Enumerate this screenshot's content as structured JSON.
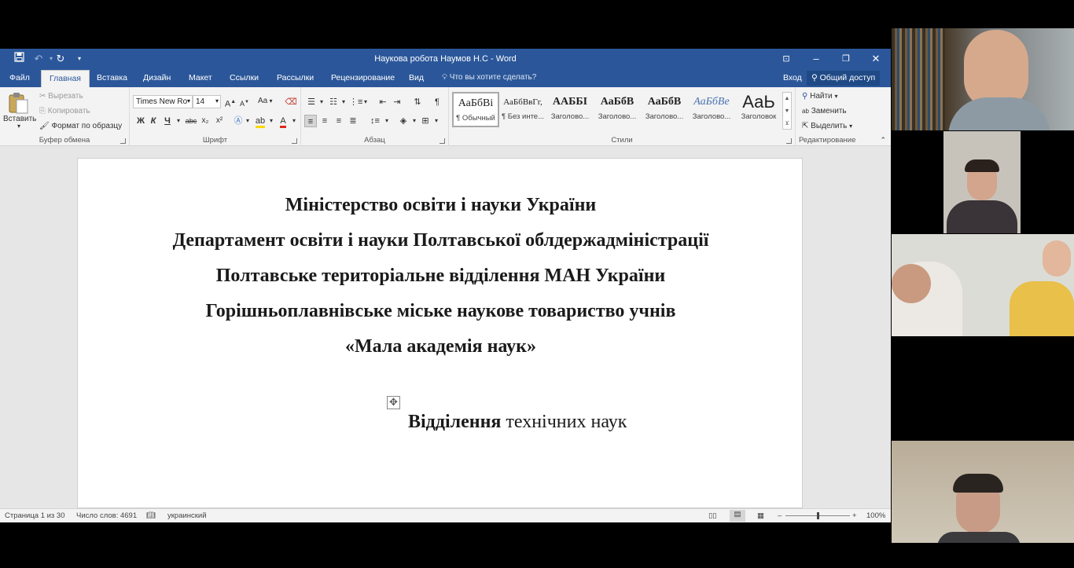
{
  "window": {
    "title": "Наукова робота Наумов Н.С - Word"
  },
  "tabs": {
    "file": "Файл",
    "home": "Главная",
    "insert": "Вставка",
    "design": "Дизайн",
    "layout": "Макет",
    "references": "Ссылки",
    "mailings": "Рассылки",
    "review": "Рецензирование",
    "view": "Вид",
    "tell_me": "Что вы хотите сделать?",
    "sign_in": "Вход",
    "share": "Общий доступ"
  },
  "ribbon": {
    "clipboard": {
      "paste": "Вставить",
      "cut": "Вырезать",
      "copy": "Копировать",
      "format_painter": "Формат по образцу",
      "label": "Буфер обмена"
    },
    "font": {
      "name": "Times New Ro",
      "size": "14",
      "bold": "Ж",
      "italic": "К",
      "underline": "Ч",
      "strike": "abc",
      "sub": "x₂",
      "sup": "x²",
      "case": "Aa",
      "label": "Шрифт"
    },
    "paragraph": {
      "label": "Абзац"
    },
    "styles": {
      "label": "Стили",
      "items": [
        {
          "preview": "АаБбВі",
          "caption": "¶ Обычный"
        },
        {
          "preview": "АаБбВвГг,",
          "caption": "¶ Без инте..."
        },
        {
          "preview": "ААББІ",
          "caption": "Заголово..."
        },
        {
          "preview": "АаБбВ",
          "caption": "Заголово..."
        },
        {
          "preview": "АаБбВ",
          "caption": "Заголово..."
        },
        {
          "preview": "АаБбВе",
          "caption": "Заголово..."
        },
        {
          "preview": "АаЬ",
          "caption": "Заголовок"
        }
      ]
    },
    "editing": {
      "find": "Найти",
      "replace": "Заменить",
      "select": "Выделить",
      "label": "Редактирование"
    }
  },
  "document": {
    "lines": [
      "Міністерство освіти і науки  України",
      "Департамент освіти і науки Полтавської облдержадміністрації",
      "Полтавське територіальне  відділення МАН України",
      "Горішньоплавнівське міське  наукове товариство учнів",
      "«Мала академія наук»"
    ],
    "department_bold": "Відділення",
    "department_rest": "  технічних наук"
  },
  "status": {
    "page": "Страница 1 из 30",
    "words": "Число слов: 4691",
    "language": "украинский",
    "zoom": "100%",
    "zoom_level_percent": 100
  },
  "colors": {
    "word_blue": "#2b579a",
    "ribbon_bg": "#f3f3f3",
    "doc_bg": "#e6e6e6"
  }
}
